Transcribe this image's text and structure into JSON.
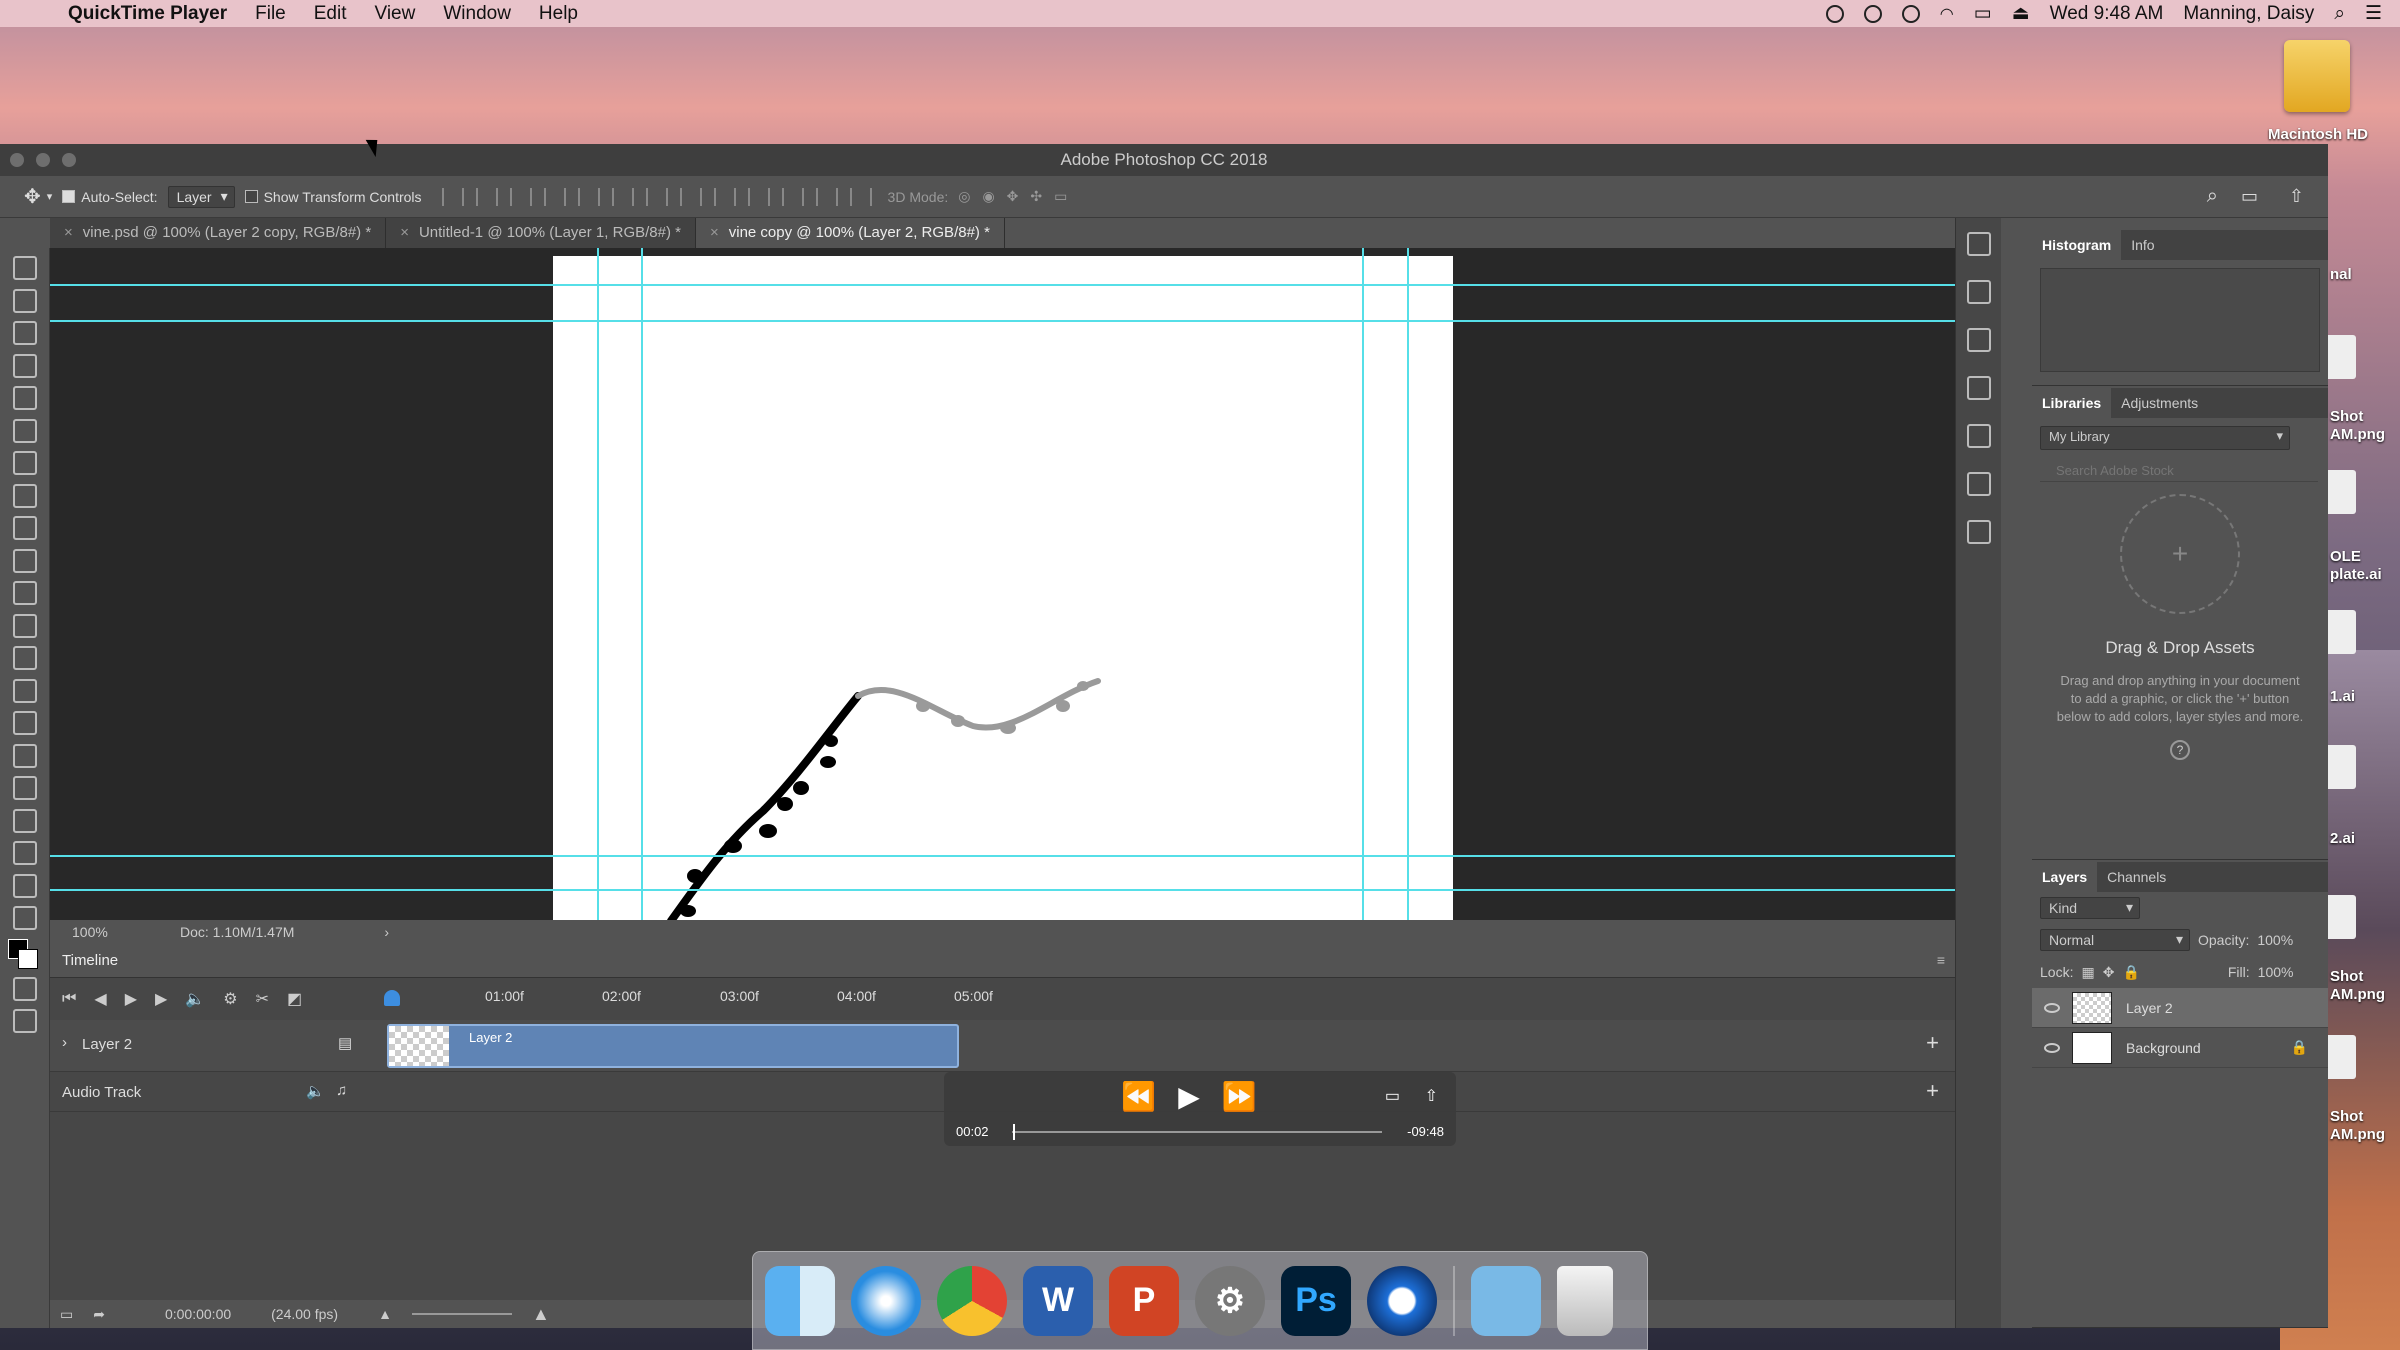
{
  "menubar": {
    "app_name": "QuickTime Player",
    "items": [
      "File",
      "Edit",
      "View",
      "Window",
      "Help"
    ],
    "clock": "Wed 9:48 AM",
    "user": "Manning, Daisy"
  },
  "desktop": {
    "hd_label": "Macintosh HD",
    "side_labels": [
      "nal",
      "Shot\nAM.png",
      "OLE\nplate.ai",
      "1.ai",
      "2.ai",
      "Shot\nAM.png",
      "Shot\nAM.png"
    ]
  },
  "window": {
    "title": "Adobe Photoshop CC 2018"
  },
  "options": {
    "auto_select_label": "Auto-Select:",
    "auto_select_value": "Layer",
    "transform_label": "Show Transform Controls",
    "mode_label": "3D Mode:"
  },
  "tabs": [
    {
      "label": "vine.psd @ 100% (Layer 2 copy, RGB/8#) *"
    },
    {
      "label": "Untitled-1 @ 100% (Layer 1, RGB/8#) *"
    },
    {
      "label": "vine copy @ 100% (Layer 2, RGB/8#) *"
    }
  ],
  "status": {
    "zoom": "100%",
    "doc": "Doc: 1.10M/1.47M"
  },
  "timeline": {
    "title": "Timeline",
    "ruler": [
      "01:00f",
      "02:00f",
      "03:00f",
      "04:00f",
      "05:00f"
    ],
    "layer_track": "Layer 2",
    "clip_label": "Layer 2",
    "audio_track": "Audio Track",
    "timecode": "0:00:00:00",
    "fps": "(24.00 fps)"
  },
  "quicktime": {
    "current": "00:02",
    "remaining": "-09:48",
    "progress": 0.003
  },
  "panels": {
    "histogram_tabs": [
      "Histogram",
      "Info"
    ],
    "library_tabs": [
      "Libraries",
      "Adjustments"
    ],
    "library_select": "My Library",
    "search_placeholder": "Search Adobe Stock",
    "drop_title": "Drag & Drop Assets",
    "drop_text": "Drag and drop anything in your document to add a graphic, or click the '+' button below to add colors, layer styles and more.",
    "layer_tabs": [
      "Layers",
      "Channels"
    ],
    "kind_label": "Kind",
    "blend_mode": "Normal",
    "opacity_label": "Opacity:",
    "opacity": "100%",
    "lock_label": "Lock:",
    "fill_label": "Fill:",
    "fill": "100%",
    "layers": [
      "Layer 2",
      "Background"
    ]
  }
}
